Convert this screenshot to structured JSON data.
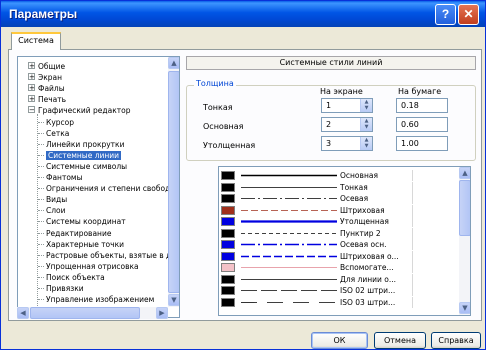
{
  "window": {
    "title": "Параметры",
    "help_glyph": "?",
    "close_glyph": "✕"
  },
  "tabs": [
    {
      "label": "Система"
    }
  ],
  "tree": {
    "nodes": [
      {
        "label": "Общие",
        "level": 0,
        "expander": "+"
      },
      {
        "label": "Экран",
        "level": 0,
        "expander": "+"
      },
      {
        "label": "Файлы",
        "level": 0,
        "expander": "+"
      },
      {
        "label": "Печать",
        "level": 0,
        "expander": "+"
      },
      {
        "label": "Графический редактор",
        "level": 0,
        "expander": "−"
      },
      {
        "label": "Курсор",
        "level": 1
      },
      {
        "label": "Сетка",
        "level": 1
      },
      {
        "label": "Линейки прокрутки",
        "level": 1
      },
      {
        "label": "Системные линии",
        "level": 1,
        "selected": true
      },
      {
        "label": "Системные символы",
        "level": 1
      },
      {
        "label": "Фантомы",
        "level": 1
      },
      {
        "label": "Ограничения и степени свободы",
        "level": 1
      },
      {
        "label": "Виды",
        "level": 1
      },
      {
        "label": "Слои",
        "level": 1
      },
      {
        "label": "Системы координат",
        "level": 1
      },
      {
        "label": "Редактирование",
        "level": 1
      },
      {
        "label": "Характерные точки",
        "level": 1
      },
      {
        "label": "Растровые объекты, взятые в документ",
        "level": 1
      },
      {
        "label": "Упрощенная отрисовка",
        "level": 1
      },
      {
        "label": "Поиск объекта",
        "level": 1
      },
      {
        "label": "Привязки",
        "level": 1
      },
      {
        "label": "Управление изображением",
        "level": 1
      }
    ]
  },
  "panel": {
    "header": "Системные стили линий",
    "thickness": {
      "title": "Толщина",
      "col_screen": "На экране",
      "col_paper": "На бумаге",
      "rows": [
        {
          "label": "Тонкая",
          "screen": "1",
          "paper": "0.18"
        },
        {
          "label": "Основная",
          "screen": "2",
          "paper": "0.60"
        },
        {
          "label": "Утолщенная",
          "screen": "3",
          "paper": "1.00"
        }
      ]
    },
    "line_styles": [
      {
        "name": "Основная",
        "swatch": "#000000",
        "color": "#000000",
        "dash": "",
        "width": 1.6
      },
      {
        "name": "Тонкая",
        "swatch": "#000000",
        "color": "#000000",
        "dash": "",
        "width": 0.8
      },
      {
        "name": "Осевая",
        "swatch": "#000000",
        "color": "#000000",
        "dash": "14 3 2 3",
        "width": 0.8
      },
      {
        "name": "Штриховая",
        "swatch": "#A0301C",
        "color": "#A0301C",
        "dash": "7 3",
        "width": 0.8
      },
      {
        "name": "Утолщенная",
        "swatch": "#0000E0",
        "color": "#0000E0",
        "dash": "",
        "width": 2.2
      },
      {
        "name": "Пунктир 2",
        "swatch": "#000000",
        "color": "#000000",
        "dash": "4 3",
        "width": 0.8
      },
      {
        "name": "Осевая осн.",
        "swatch": "#0000E0",
        "color": "#0000E0",
        "dash": "14 3 2 3",
        "width": 1.6
      },
      {
        "name": "Штриховая о...",
        "swatch": "#0000E0",
        "color": "#0000E0",
        "dash": "8 3",
        "width": 1.6
      },
      {
        "name": "Вспомогате...",
        "swatch": "#F4C2C8",
        "color": "#E08590",
        "dash": "",
        "width": 0.8
      },
      {
        "name": "Для линии о...",
        "swatch": "#000000",
        "color": "#000000",
        "dash": "",
        "width": 0.8
      },
      {
        "name": "ISO 02 штри...",
        "swatch": "#000000",
        "color": "#000000",
        "dash": "16 4",
        "width": 0.8
      },
      {
        "name": "ISO 03 штри...",
        "swatch": "#000000",
        "color": "#000000",
        "dash": "16 10",
        "width": 0.8
      }
    ]
  },
  "buttons": {
    "ok": "ОК",
    "cancel": "Отмена",
    "help": "Справка"
  },
  "colors": {
    "title_bar": "#0055E5",
    "selection": "#316AC5",
    "group_title": "#0046D5"
  }
}
